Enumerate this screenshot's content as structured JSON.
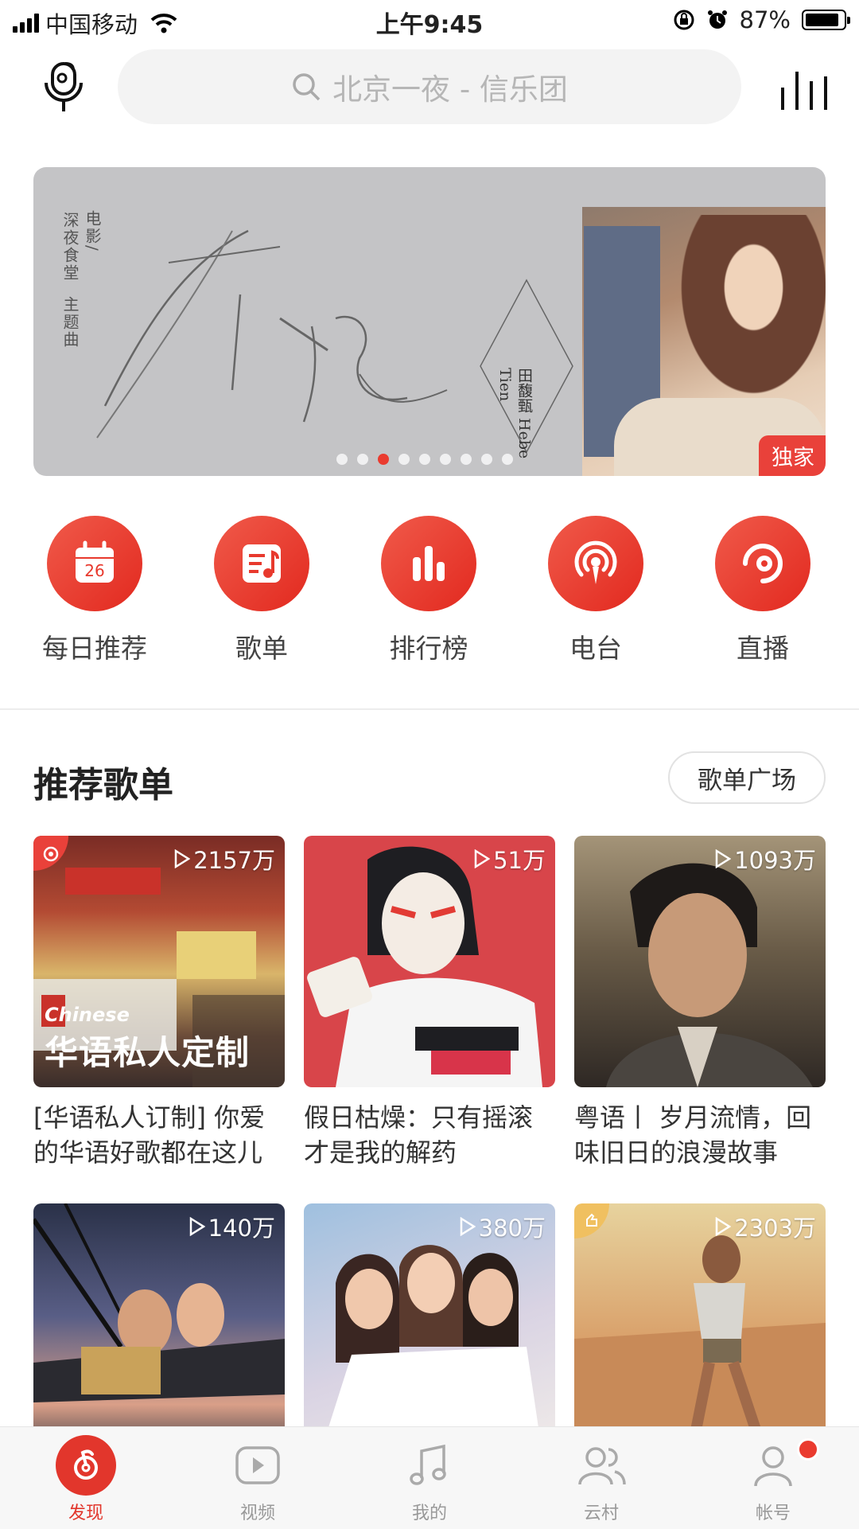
{
  "status_bar": {
    "carrier": "中国移动",
    "time": "上午9:45",
    "battery": "87%"
  },
  "search": {
    "placeholder": "北京一夜 - 信乐团"
  },
  "banner": {
    "vertical_text": [
      "电影/",
      "深夜食堂",
      "主题曲"
    ],
    "artist": "田馥甄 Hebe Tien",
    "tag": "独家",
    "dots": 9,
    "active_dot": 3
  },
  "nav": [
    {
      "label": "每日推荐",
      "icon": "calendar-icon",
      "day": "26"
    },
    {
      "label": "歌单",
      "icon": "playlist-icon"
    },
    {
      "label": "排行榜",
      "icon": "chart-bars-icon"
    },
    {
      "label": "电台",
      "icon": "radio-icon"
    },
    {
      "label": "直播",
      "icon": "live-icon"
    }
  ],
  "section": {
    "title": "推荐歌单",
    "button": "歌单广场"
  },
  "playlists": [
    {
      "count": "2157万",
      "desc": "[华语私人订制] 你爱的华语好歌都在这儿",
      "overlay_en": "Chinese",
      "overlay_zh": "华语私人定制"
    },
    {
      "count": "51万",
      "desc": "假日枯燥：只有摇滚才是我的解药"
    },
    {
      "count": "1093万",
      "desc": "粤语丨 岁月流情，回味旧日的浪漫故事"
    },
    {
      "count": "140万",
      "desc": ""
    },
    {
      "count": "380万",
      "desc": ""
    },
    {
      "count": "2303万",
      "desc": ""
    }
  ],
  "tabs": [
    {
      "label": "发现",
      "icon": "netease-music-icon",
      "active": true
    },
    {
      "label": "视频",
      "icon": "video-play-icon"
    },
    {
      "label": "我的",
      "icon": "music-note-icon"
    },
    {
      "label": "云村",
      "icon": "friends-icon"
    },
    {
      "label": "帐号",
      "icon": "user-icon"
    }
  ],
  "colors": {
    "accent": "#e2362c",
    "banner_bg": "#c4c4c6"
  }
}
